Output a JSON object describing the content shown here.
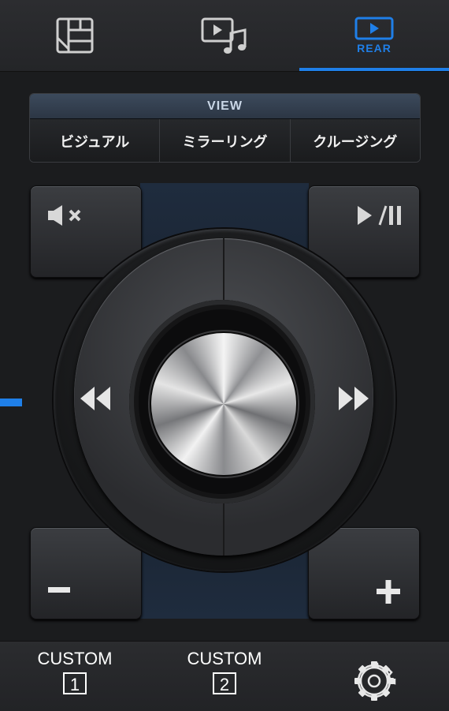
{
  "tabs": [
    {
      "name": "tab-source",
      "icon": "grid-panel-icon"
    },
    {
      "name": "tab-media",
      "icon": "video-music-icon"
    },
    {
      "name": "tab-rear",
      "icon": "rear-screen-icon",
      "label": "REAR",
      "active": true
    }
  ],
  "view": {
    "header": "VIEW",
    "options": [
      "ビジュアル",
      "ミラーリング",
      "クルージング"
    ]
  },
  "controls": {
    "mute_icon": "mute-icon",
    "play_pause_icon": "play-pause-icon",
    "rewind_icon": "rewind-icon",
    "fast_forward_icon": "fast-forward-icon",
    "volume_down_icon": "minus-icon",
    "volume_up_icon": "plus-icon"
  },
  "bottom": {
    "custom1": {
      "label": "CUSTOM",
      "number": "1"
    },
    "custom2": {
      "label": "CUSTOM",
      "number": "2"
    },
    "settings_icon": "gear-icon"
  },
  "colors": {
    "accent": "#1f7fe8",
    "background": "#1b1c1e"
  }
}
